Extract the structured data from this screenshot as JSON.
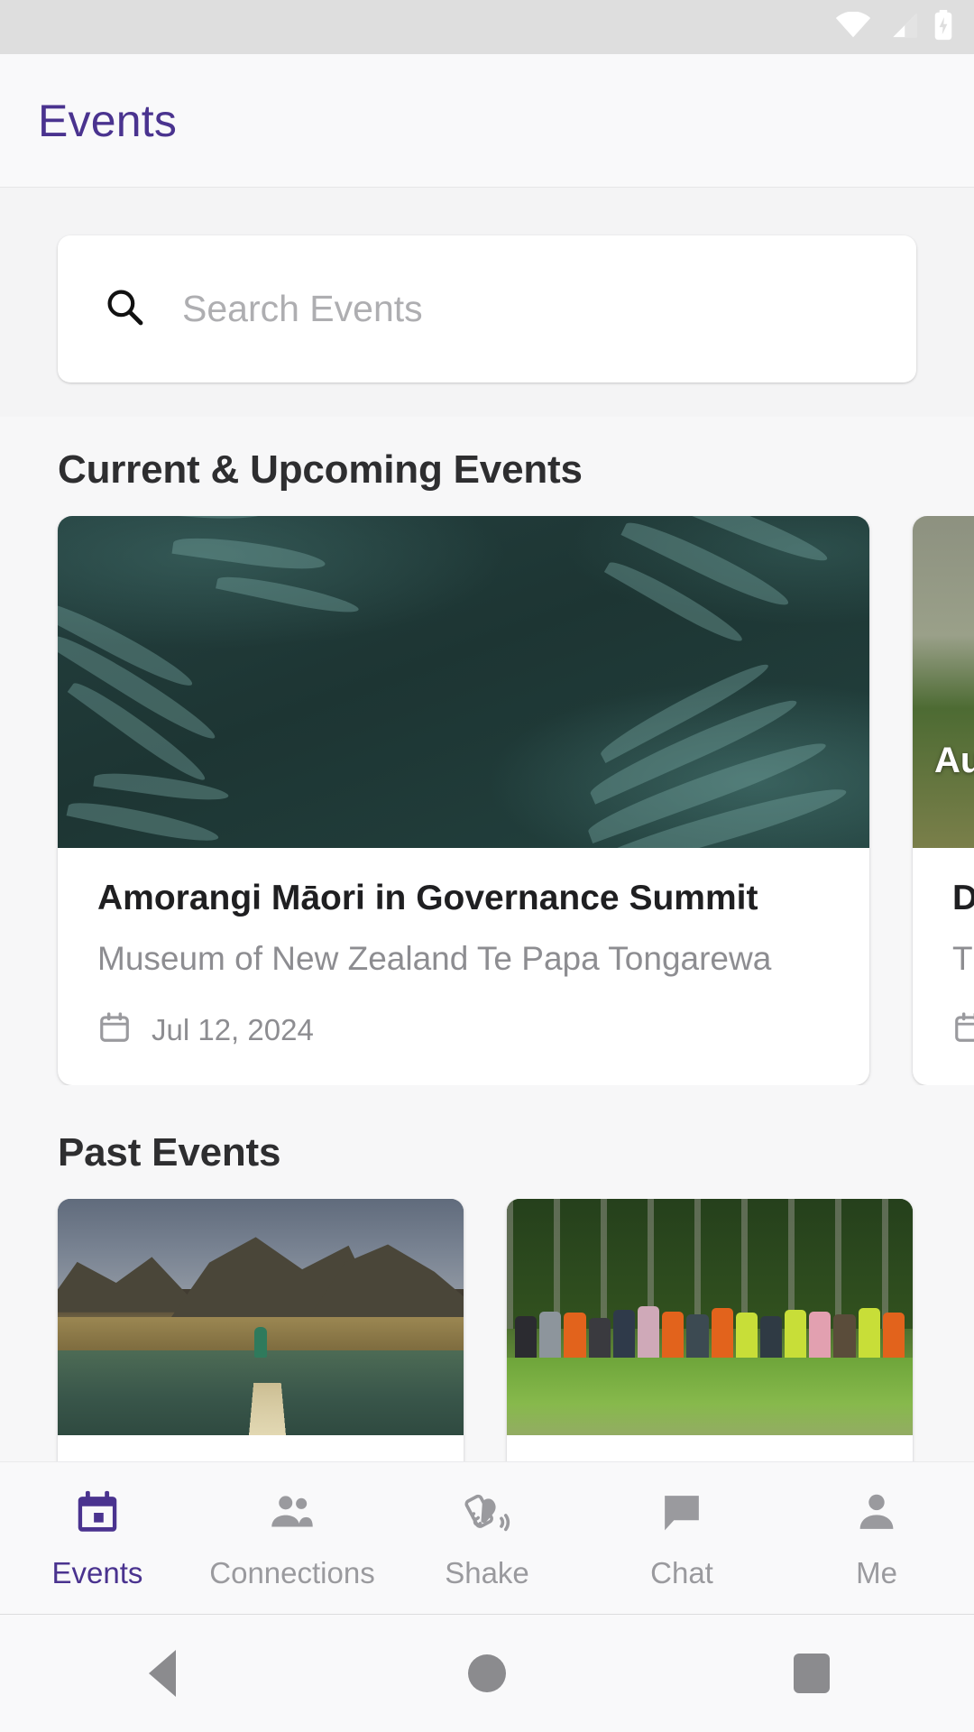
{
  "status_bar": {
    "wifi_icon": "wifi-icon",
    "signal_icon": "cellular-signal-icon",
    "battery_icon": "battery-charging-icon"
  },
  "app_bar": {
    "title": "Events",
    "title_color": "#4a338f"
  },
  "search": {
    "icon": "search-icon",
    "placeholder": "Search Events",
    "value": ""
  },
  "sections": {
    "upcoming_title": "Current & Upcoming Events",
    "past_title": "Past Events"
  },
  "upcoming_events": [
    {
      "title": "Amorangi Māori in Governance Summit",
      "venue": "Museum of New Zealand Te Papa Tongarewa",
      "date": "Jul 12, 2024",
      "date_icon": "calendar-icon",
      "image": "silver-fern-photo",
      "image_caption": ""
    },
    {
      "title": "DI",
      "venue": "TS",
      "date": "",
      "date_icon": "calendar-icon",
      "image": "kowhai-flower-photo",
      "image_caption": "Aua"
    }
  ],
  "past_events": [
    {
      "title": "",
      "venue": "",
      "date": "",
      "image": "lake-boardwalk-mountains-photo"
    },
    {
      "title": "",
      "venue": "",
      "date": "",
      "image": "group-photo-forest-hivis"
    }
  ],
  "bottom_nav": {
    "active_index": 0,
    "items": [
      {
        "label": "Events",
        "icon": "calendar-icon"
      },
      {
        "label": "Connections",
        "icon": "people-icon"
      },
      {
        "label": "Shake",
        "icon": "shake-phone-icon"
      },
      {
        "label": "Chat",
        "icon": "chat-bubble-icon"
      },
      {
        "label": "Me",
        "icon": "person-icon"
      }
    ]
  },
  "system_nav": {
    "back": "back-triangle-icon",
    "home": "home-circle-icon",
    "recents": "recents-square-icon"
  },
  "colors": {
    "accent": "#4a338f",
    "page_bg": "#f7f7f8",
    "card_bg": "#ffffff",
    "muted_text": "#8d8d91"
  }
}
